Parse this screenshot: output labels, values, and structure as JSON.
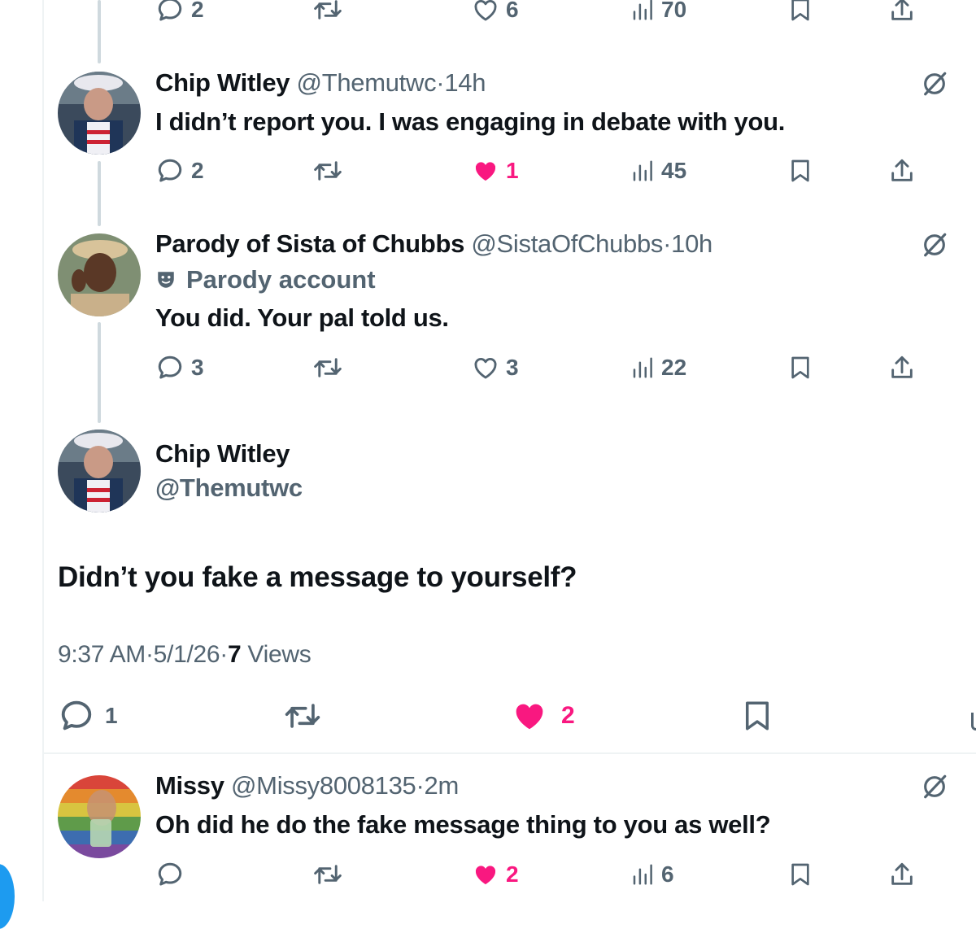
{
  "tweets": [
    {
      "replies": "2",
      "likes": "6",
      "views": "70",
      "liked": false
    },
    {
      "name": "Chip Witley",
      "handle": "@Themutwc",
      "time": "14h",
      "text": "I didn’t report you. I was engaging in debate with you.",
      "replies": "2",
      "likes": "1",
      "views": "45",
      "liked": true
    },
    {
      "name": "Parody of Sista of Chubbs",
      "handle": "@SistaOfChubbs",
      "time": "10h",
      "badge": "Parody account",
      "text": "You did. Your pal told us.",
      "replies": "3",
      "likes": "3",
      "views": "22",
      "liked": false
    }
  ],
  "focused": {
    "name": "Chip Witley",
    "handle": "@Themutwc",
    "text": "Didn’t you fake a message to yourself?",
    "time": "9:37 AM",
    "date": "5/1/26",
    "views_count": "7",
    "views_label": "Views",
    "replies": "1",
    "likes": "2"
  },
  "reply": {
    "name": "Missy",
    "handle": "@Missy8008135",
    "time": "2m",
    "text": "Oh did he do the fake message thing to you as well?",
    "replies": "",
    "likes": "2",
    "views": "6",
    "liked": true
  },
  "separator": "·",
  "icons": {
    "reply": "reply-icon",
    "retweet": "retweet-icon",
    "like": "heart-icon",
    "views": "views-icon",
    "bookmark": "bookmark-icon",
    "share": "share-icon",
    "grok": "grok-icon",
    "parody": "parody-mask-icon"
  },
  "colors": {
    "text": "#0f1419",
    "muted": "#536471",
    "like": "#f91880",
    "thread_line": "#cfd9de",
    "accent": "#1d9bf0"
  }
}
